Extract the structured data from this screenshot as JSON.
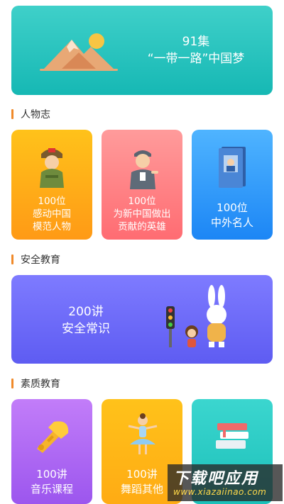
{
  "banner": {
    "line1": "91集",
    "line2": "“一带一路”中国梦",
    "icon": "mountain-sun-icon"
  },
  "sections": {
    "people": {
      "title": "人物志"
    },
    "safety": {
      "title": "安全教育"
    },
    "quality": {
      "title": "素质教育"
    }
  },
  "people_cards": [
    {
      "line1": "100位",
      "line2": "感动中国",
      "line3": "模范人物",
      "icon": "soldier-icon"
    },
    {
      "line1": "100位",
      "line2": "为新中国做出",
      "line3": "贡献的英雄",
      "icon": "hero-icon"
    },
    {
      "line1": "100位",
      "line2": "中外名人",
      "icon": "book-icon"
    }
  ],
  "safety_card": {
    "line1": "200讲",
    "line2": "安全常识",
    "icon": "traffic-light-rabbit-icon"
  },
  "quality_cards": [
    {
      "line1": "100讲",
      "line2": "音乐课程",
      "icon": "trumpet-icon"
    },
    {
      "line1": "100讲",
      "line2": "舞蹈其他",
      "icon": "ballerina-icon"
    },
    {
      "icon": "books-icon"
    }
  ],
  "watermark": {
    "line1": "下载吧应用",
    "line2": "www.xiazaiinao.com"
  },
  "colors": {
    "banner": "#16b8b4",
    "accent_bar": "#f08a2a",
    "orange": "#ff9a16",
    "red": "#ff6c72",
    "blue": "#1c86f5",
    "purple": "#9c56ee",
    "yellow": "#ffab14",
    "teal": "#1cc0b9",
    "safety": "#5e5cf2"
  }
}
